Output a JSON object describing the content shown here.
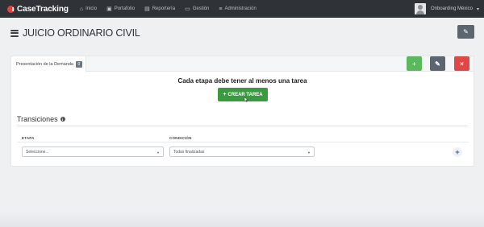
{
  "navbar": {
    "brand": "CaseTracking",
    "items": [
      {
        "icon": "home-icon",
        "glyph": "⌂",
        "label": "Inicio"
      },
      {
        "icon": "briefcase-icon",
        "glyph": "▣",
        "label": "Portafolio"
      },
      {
        "icon": "chart-icon",
        "glyph": "▤",
        "label": "Reportería"
      },
      {
        "icon": "folder-icon",
        "glyph": "▭",
        "label": "Gestión"
      },
      {
        "icon": "list-icon",
        "glyph": "≡",
        "label": "Administración"
      }
    ],
    "user_name": "Onboarding México"
  },
  "header": {
    "title": "JUICIO ORDINARIO CIVIL"
  },
  "card": {
    "tab_label": "Presentación de la Demanda",
    "tab_badge": "0",
    "notice": "Cada etapa debe tener al menos una tarea",
    "create_button": "CREAR TAREA",
    "transitions_title": "Transiciones",
    "columns": {
      "etapa": "ETAPA",
      "condicion": "CONDICIÓN"
    },
    "etapa_value": "Seleccione...",
    "condicion_value": "Todas finalizadas"
  },
  "colors": {
    "navbar": "#2f3337",
    "brand_accent": "#e8413b",
    "add": "#5cb85c",
    "edit": "#5b6671",
    "delete": "#e04848",
    "create": "#3a9a3f"
  }
}
